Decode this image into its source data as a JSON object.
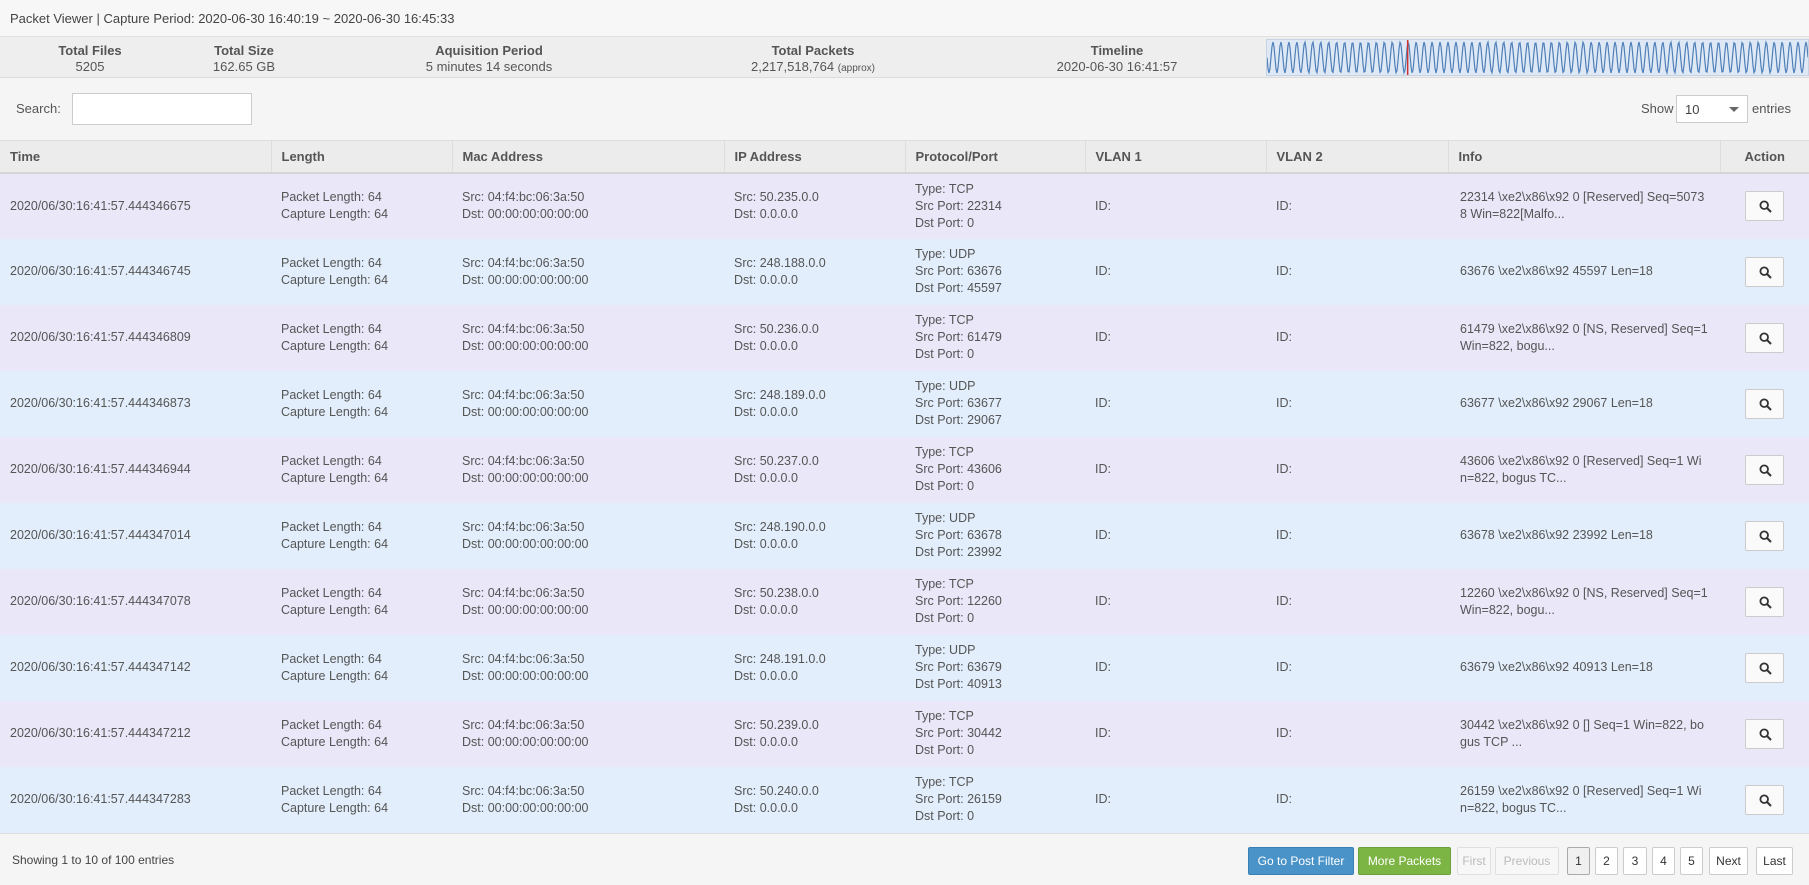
{
  "title": {
    "app": "Packet Viewer",
    "separator": "|",
    "capture_label": "Capture Period:",
    "capture_range": "2020-06-30 16:40:19 ~ 2020-06-30 16:45:33"
  },
  "stats": {
    "total_files": {
      "label": "Total Files",
      "value": "5205"
    },
    "total_size": {
      "label": "Total Size",
      "value": "162.65 GB"
    },
    "acquisition_period": {
      "label": "Aquisition Period",
      "value": "5 minutes 14 seconds"
    },
    "total_packets": {
      "label": "Total Packets",
      "value": "2,217,518,764",
      "note": "(approx)"
    },
    "timeline": {
      "label": "Timeline",
      "value": "2020-06-30 16:41:57",
      "marker_position": 0.26
    }
  },
  "toolbar": {
    "search_label": "Search:",
    "search_value": "",
    "show_label": "Show",
    "show_value": "10",
    "entries_label": "entries"
  },
  "table": {
    "columns": [
      "Time",
      "Length",
      "Mac Address",
      "IP Address",
      "Protocol/Port",
      "VLAN 1",
      "VLAN 2",
      "Info",
      "Action"
    ],
    "rows": [
      {
        "time": "2020/06/30:16:41:57.444346675",
        "pkt_len": "Packet Length: 64",
        "cap_len": "Capture Length: 64",
        "mac_src": "Src: 04:f4:bc:06:3a:50",
        "mac_dst": "Dst: 00:00:00:00:00:00",
        "ip_src": "Src: 50.235.0.0",
        "ip_dst": "Dst: 0.0.0.0",
        "type": "Type: TCP",
        "src_port": "Src Port: 22314",
        "dst_port": "Dst Port: 0",
        "vlan1": "ID:",
        "vlan2": "ID:",
        "info": "22314 \\xe2\\x86\\x92 0 [Reserved] Seq=5073 8 Win=822[Malfo..."
      },
      {
        "time": "2020/06/30:16:41:57.444346745",
        "pkt_len": "Packet Length: 64",
        "cap_len": "Capture Length: 64",
        "mac_src": "Src: 04:f4:bc:06:3a:50",
        "mac_dst": "Dst: 00:00:00:00:00:00",
        "ip_src": "Src: 248.188.0.0",
        "ip_dst": "Dst: 0.0.0.0",
        "type": "Type: UDP",
        "src_port": "Src Port: 63676",
        "dst_port": "Dst Port: 45597",
        "vlan1": "ID:",
        "vlan2": "ID:",
        "info": "63676 \\xe2\\x86\\x92 45597 Len=18"
      },
      {
        "time": "2020/06/30:16:41:57.444346809",
        "pkt_len": "Packet Length: 64",
        "cap_len": "Capture Length: 64",
        "mac_src": "Src: 04:f4:bc:06:3a:50",
        "mac_dst": "Dst: 00:00:00:00:00:00",
        "ip_src": "Src: 50.236.0.0",
        "ip_dst": "Dst: 0.0.0.0",
        "type": "Type: TCP",
        "src_port": "Src Port: 61479",
        "dst_port": "Dst Port: 0",
        "vlan1": "ID:",
        "vlan2": "ID:",
        "info": "61479 \\xe2\\x86\\x92 0 [NS, Reserved] Seq=1 Win=822, bogu..."
      },
      {
        "time": "2020/06/30:16:41:57.444346873",
        "pkt_len": "Packet Length: 64",
        "cap_len": "Capture Length: 64",
        "mac_src": "Src: 04:f4:bc:06:3a:50",
        "mac_dst": "Dst: 00:00:00:00:00:00",
        "ip_src": "Src: 248.189.0.0",
        "ip_dst": "Dst: 0.0.0.0",
        "type": "Type: UDP",
        "src_port": "Src Port: 63677",
        "dst_port": "Dst Port: 29067",
        "vlan1": "ID:",
        "vlan2": "ID:",
        "info": "63677 \\xe2\\x86\\x92 29067 Len=18"
      },
      {
        "time": "2020/06/30:16:41:57.444346944",
        "pkt_len": "Packet Length: 64",
        "cap_len": "Capture Length: 64",
        "mac_src": "Src: 04:f4:bc:06:3a:50",
        "mac_dst": "Dst: 00:00:00:00:00:00",
        "ip_src": "Src: 50.237.0.0",
        "ip_dst": "Dst: 0.0.0.0",
        "type": "Type: TCP",
        "src_port": "Src Port: 43606",
        "dst_port": "Dst Port: 0",
        "vlan1": "ID:",
        "vlan2": "ID:",
        "info": "43606 \\xe2\\x86\\x92 0 [Reserved] Seq=1 Wi n=822, bogus TC..."
      },
      {
        "time": "2020/06/30:16:41:57.444347014",
        "pkt_len": "Packet Length: 64",
        "cap_len": "Capture Length: 64",
        "mac_src": "Src: 04:f4:bc:06:3a:50",
        "mac_dst": "Dst: 00:00:00:00:00:00",
        "ip_src": "Src: 248.190.0.0",
        "ip_dst": "Dst: 0.0.0.0",
        "type": "Type: UDP",
        "src_port": "Src Port: 63678",
        "dst_port": "Dst Port: 23992",
        "vlan1": "ID:",
        "vlan2": "ID:",
        "info": "63678 \\xe2\\x86\\x92 23992 Len=18"
      },
      {
        "time": "2020/06/30:16:41:57.444347078",
        "pkt_len": "Packet Length: 64",
        "cap_len": "Capture Length: 64",
        "mac_src": "Src: 04:f4:bc:06:3a:50",
        "mac_dst": "Dst: 00:00:00:00:00:00",
        "ip_src": "Src: 50.238.0.0",
        "ip_dst": "Dst: 0.0.0.0",
        "type": "Type: TCP",
        "src_port": "Src Port: 12260",
        "dst_port": "Dst Port: 0",
        "vlan1": "ID:",
        "vlan2": "ID:",
        "info": "12260 \\xe2\\x86\\x92 0 [NS, Reserved] Seq=1 Win=822, bogu..."
      },
      {
        "time": "2020/06/30:16:41:57.444347142",
        "pkt_len": "Packet Length: 64",
        "cap_len": "Capture Length: 64",
        "mac_src": "Src: 04:f4:bc:06:3a:50",
        "mac_dst": "Dst: 00:00:00:00:00:00",
        "ip_src": "Src: 248.191.0.0",
        "ip_dst": "Dst: 0.0.0.0",
        "type": "Type: UDP",
        "src_port": "Src Port: 63679",
        "dst_port": "Dst Port: 40913",
        "vlan1": "ID:",
        "vlan2": "ID:",
        "info": "63679 \\xe2\\x86\\x92 40913 Len=18"
      },
      {
        "time": "2020/06/30:16:41:57.444347212",
        "pkt_len": "Packet Length: 64",
        "cap_len": "Capture Length: 64",
        "mac_src": "Src: 04:f4:bc:06:3a:50",
        "mac_dst": "Dst: 00:00:00:00:00:00",
        "ip_src": "Src: 50.239.0.0",
        "ip_dst": "Dst: 0.0.0.0",
        "type": "Type: TCP",
        "src_port": "Src Port: 30442",
        "dst_port": "Dst Port: 0",
        "vlan1": "ID:",
        "vlan2": "ID:",
        "info": "30442 \\xe2\\x86\\x92 0 [] Seq=1 Win=822, bo gus TCP ..."
      },
      {
        "time": "2020/06/30:16:41:57.444347283",
        "pkt_len": "Packet Length: 64",
        "cap_len": "Capture Length: 64",
        "mac_src": "Src: 04:f4:bc:06:3a:50",
        "mac_dst": "Dst: 00:00:00:00:00:00",
        "ip_src": "Src: 50.240.0.0",
        "ip_dst": "Dst: 0.0.0.0",
        "type": "Type: TCP",
        "src_port": "Src Port: 26159",
        "dst_port": "Dst Port: 0",
        "vlan1": "ID:",
        "vlan2": "ID:",
        "info": "26159 \\xe2\\x86\\x92 0 [Reserved] Seq=1 Wi n=822, bogus TC..."
      }
    ],
    "action_icon": "search-icon"
  },
  "footer": {
    "showing": "Showing 1 to 10 of 100 entries",
    "post_filter": "Go to Post Filter",
    "more_packets": "More Packets",
    "first": "First",
    "previous": "Previous",
    "pages": [
      "1",
      "2",
      "3",
      "4",
      "5"
    ],
    "current_page": "1",
    "next": "Next",
    "last": "Last"
  },
  "colors": {
    "row_odd": "#e9e7f8",
    "row_even": "#e2eefb",
    "primary_button": "#4a93c8",
    "success_button": "#7db545",
    "timeline_wave": "#4f7fb8",
    "timeline_marker": "#cc3333"
  }
}
